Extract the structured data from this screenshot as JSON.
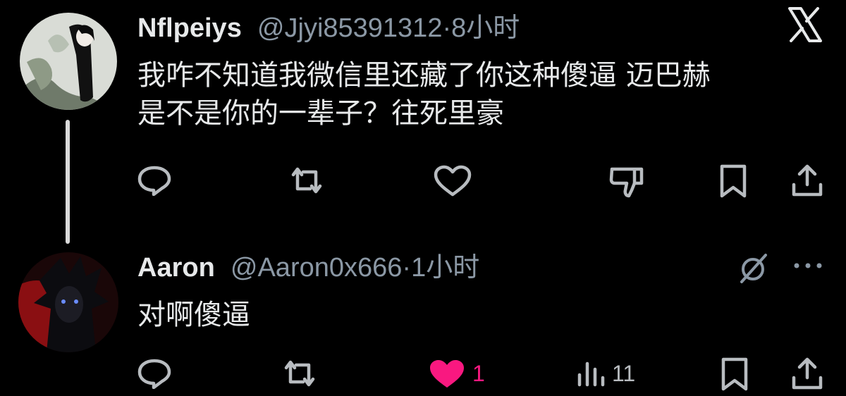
{
  "post1": {
    "display_name": "Nflpeiys",
    "handle": "@Jjyi85391312",
    "separator": "·",
    "time": "8小时",
    "text_line1": "我咋不知道我微信里还藏了你这种傻逼 迈巴赫",
    "text_line2": "是不是你的一辈子？往死里豪",
    "icons": [
      "reply-icon",
      "repost-icon",
      "like-icon",
      "dislike-icon",
      "bookmark-icon",
      "share-icon"
    ]
  },
  "post2": {
    "display_name": "Aaron",
    "handle": "@Aaron0x666",
    "separator": "·",
    "time": "1小时",
    "text": "对啊傻逼",
    "like_count": "1",
    "views_count": "11",
    "icons": [
      "reply-icon",
      "repost-icon",
      "like-icon-filled",
      "views-icon",
      "bookmark-icon",
      "share-icon",
      "grok-icon",
      "more-icon"
    ]
  },
  "brand_icon": "x-logo-icon",
  "colors": {
    "background": "#000000",
    "text_primary": "#e7e9ea",
    "text_secondary": "#8b98a5",
    "icon": "#b8bcc0",
    "like_active": "#f91880",
    "thread_line": "#d9d9d9"
  }
}
